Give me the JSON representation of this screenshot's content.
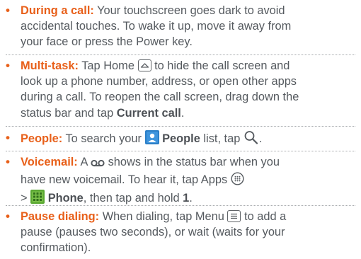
{
  "tips": [
    {
      "term": "During a call:",
      "line1": "Your touchscreen goes dark to avoid",
      "line2": "accidental touches. To wake it up, move it away from",
      "line3": "your face or press the Power key."
    },
    {
      "term": "Multi-task:",
      "line1_a": "Tap Home",
      "line1_b": "to hide the call screen and",
      "line2": "look up a phone number, address, or open other apps",
      "line3": "during a call. To reopen the call screen, drag down the",
      "line4_a": "status bar and tap",
      "line4_strong": "Current call",
      "line4_end": "."
    },
    {
      "term": "People:",
      "line1_a": "To search your",
      "line1_strong": "People",
      "line1_b": "list, tap",
      "line1_end": "."
    },
    {
      "term": "Voicemail:",
      "line1_a": "A",
      "line1_b": "shows in the status bar when you",
      "line2": "have new voicemail. To hear it, tap Apps",
      "line3_a": ">",
      "line3_strong": "Phone",
      "line3_b": ", then tap and hold",
      "line3_strong2": "1",
      "line3_end": "."
    },
    {
      "term": "Pause dialing:",
      "line1_a": "When dialing, tap Menu",
      "line1_b": "to add a",
      "line2": "pause (pauses two seconds), or wait (waits for your",
      "line3": "confirmation)."
    }
  ],
  "bullet": "•",
  "colors": {
    "accent": "#e8601a",
    "text": "#555a5f",
    "people_icon": "#2b7fc7",
    "phone_icon": "#5aa832"
  },
  "icons": [
    "home-key-icon",
    "search-icon",
    "people-app-icon",
    "voicemail-icon",
    "apps-icon",
    "phone-app-icon",
    "menu-key-icon"
  ]
}
